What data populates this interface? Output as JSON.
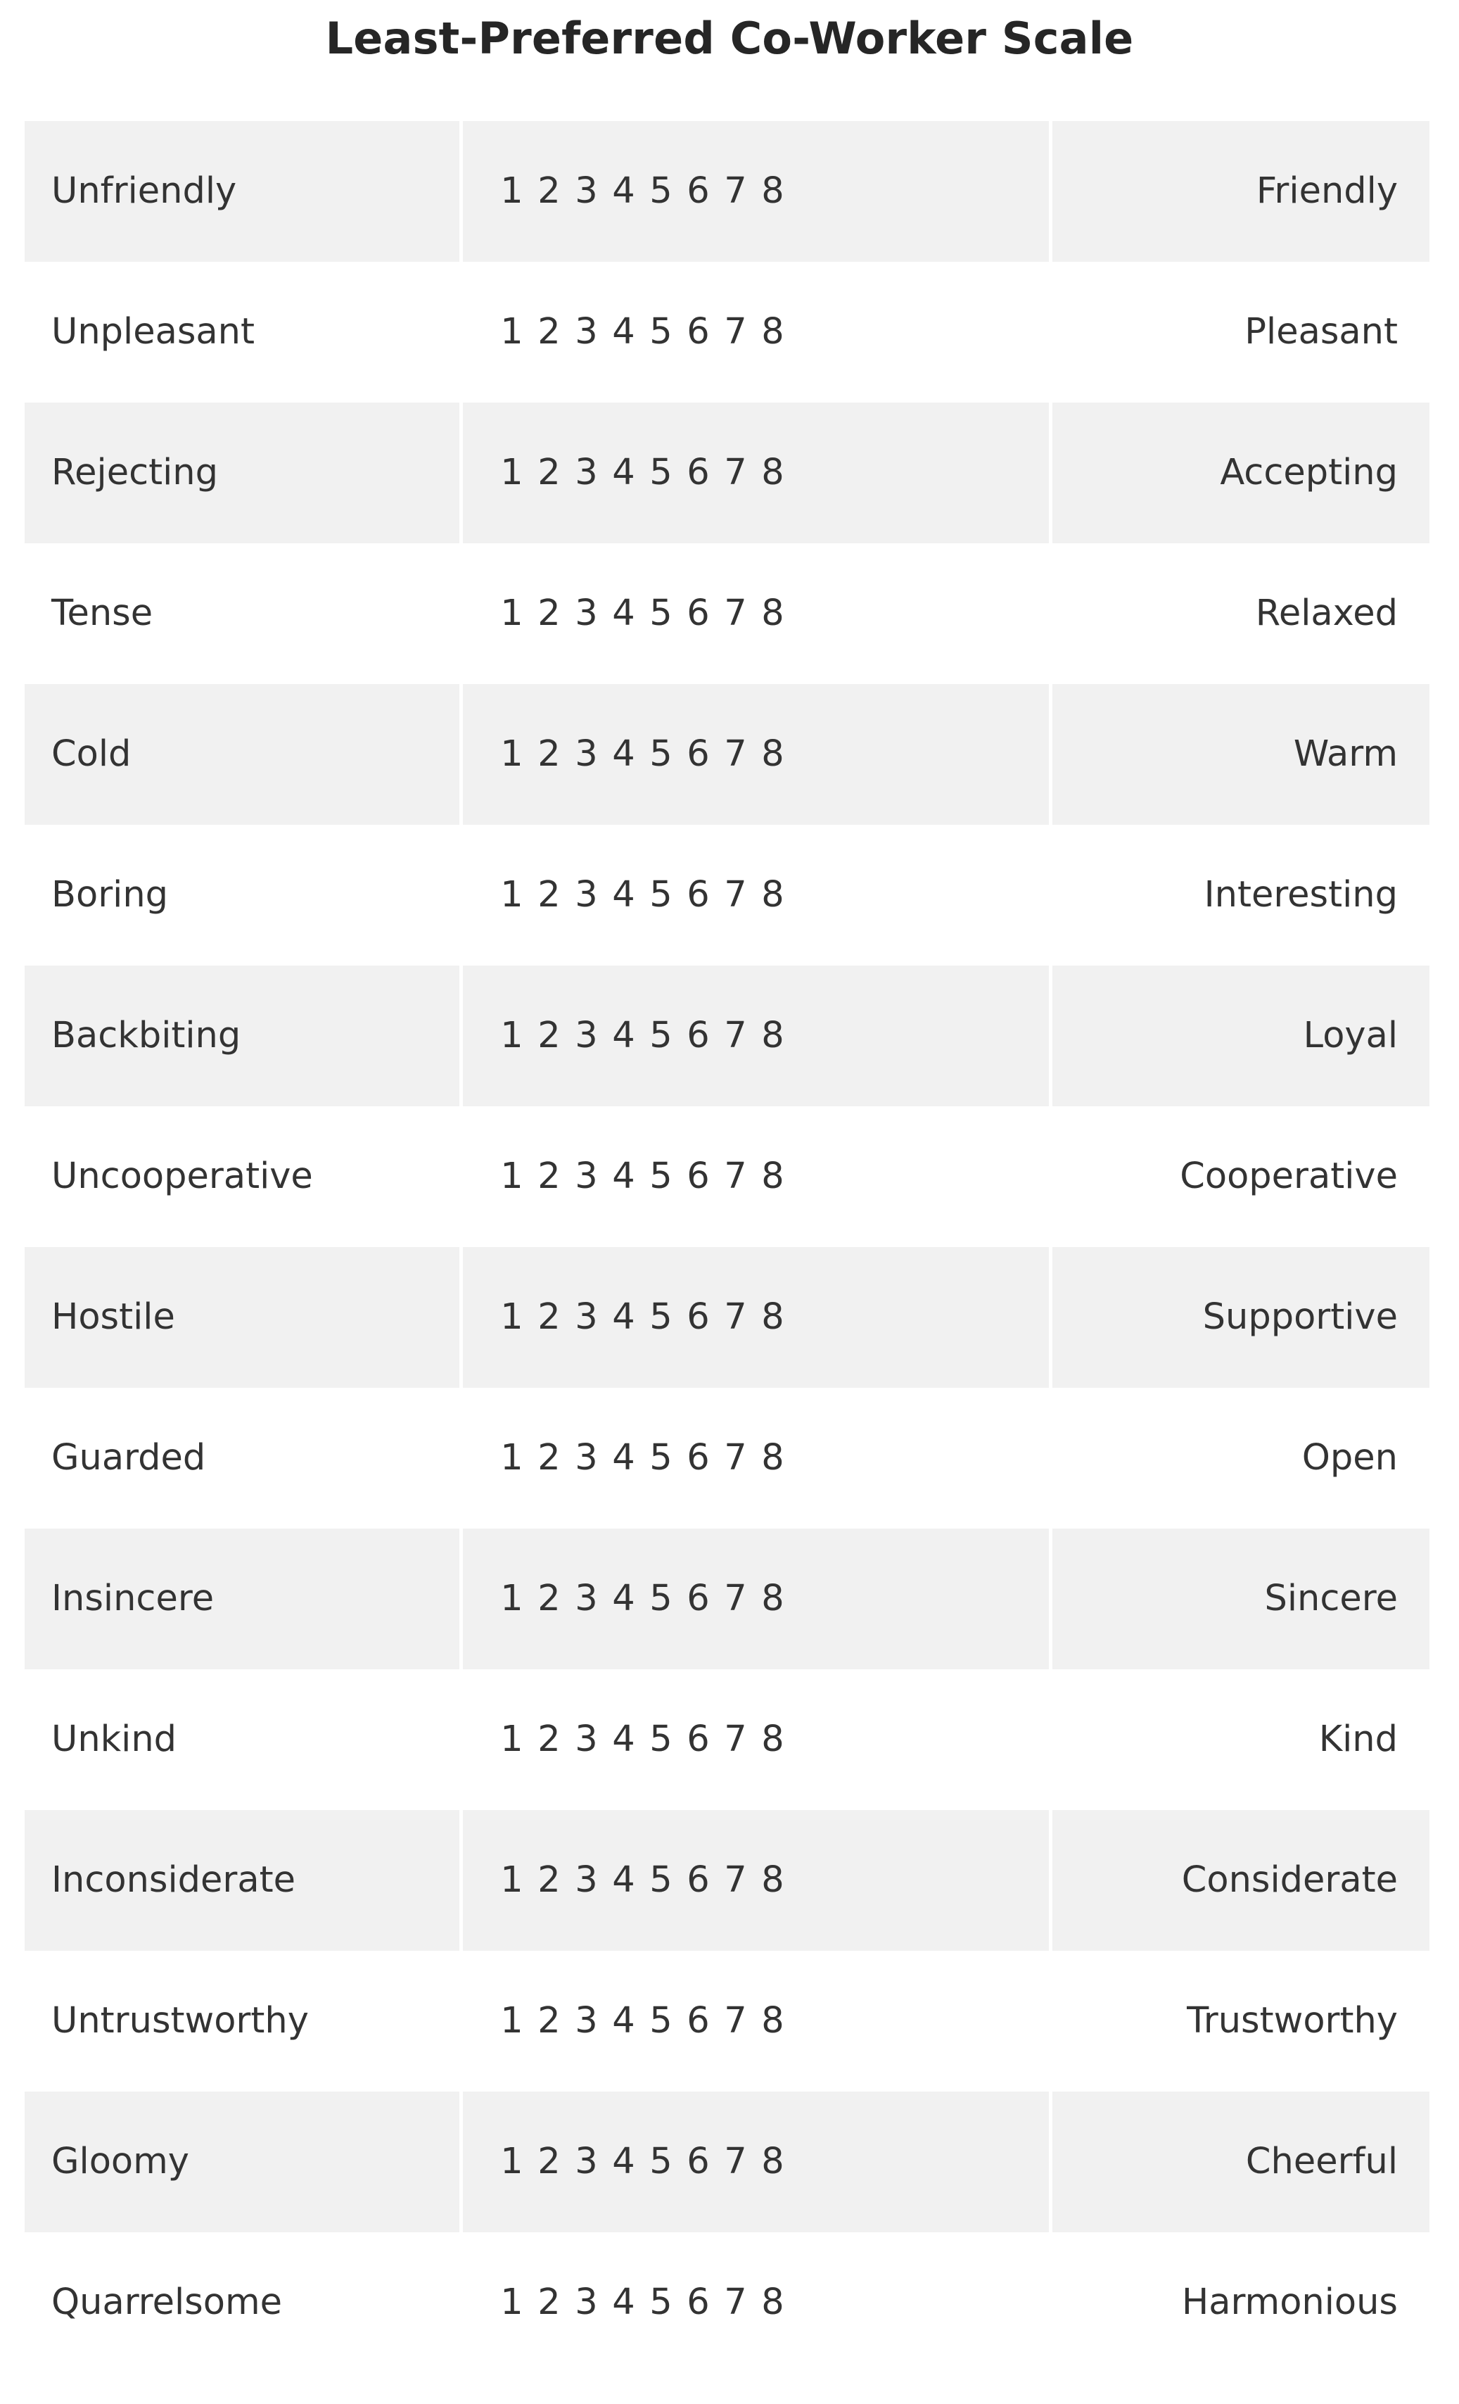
{
  "title": "Least-Preferred Co-Worker Scale",
  "colors": {
    "page_background": "#ffffff",
    "row_shade": "#f1f1f1",
    "text": "#333333",
    "title_text": "#262626"
  },
  "scale": {
    "points": [
      "1",
      "2",
      "3",
      "4",
      "5",
      "6",
      "7",
      "8"
    ],
    "min": 1,
    "max": 8
  },
  "items": [
    {
      "negative": "Unfriendly",
      "positive": "Friendly"
    },
    {
      "negative": "Unpleasant",
      "positive": "Pleasant"
    },
    {
      "negative": "Rejecting",
      "positive": "Accepting"
    },
    {
      "negative": "Tense",
      "positive": "Relaxed"
    },
    {
      "negative": "Cold",
      "positive": "Warm"
    },
    {
      "negative": "Boring",
      "positive": "Interesting"
    },
    {
      "negative": "Backbiting",
      "positive": "Loyal"
    },
    {
      "negative": "Uncooperative",
      "positive": "Cooperative"
    },
    {
      "negative": "Hostile",
      "positive": "Supportive"
    },
    {
      "negative": "Guarded",
      "positive": "Open"
    },
    {
      "negative": "Insincere",
      "positive": "Sincere"
    },
    {
      "negative": "Unkind",
      "positive": "Kind"
    },
    {
      "negative": "Inconsiderate",
      "positive": "Considerate"
    },
    {
      "negative": "Untrustworthy",
      "positive": "Trustworthy"
    },
    {
      "negative": "Gloomy",
      "positive": "Cheerful"
    },
    {
      "negative": "Quarrelsome",
      "positive": "Harmonious"
    }
  ]
}
